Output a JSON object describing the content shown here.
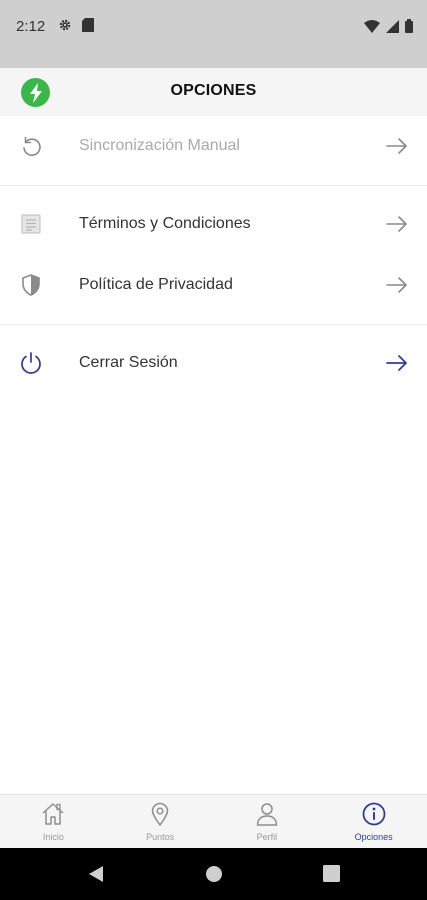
{
  "status_bar": {
    "time": "2:12",
    "icons": [
      "settings-icon",
      "sim-card-icon",
      "wifi-icon",
      "signal-icon",
      "battery-icon"
    ]
  },
  "header": {
    "title": "OPCIONES",
    "logo_icon": "bolt-icon",
    "logo_color": "#3cb64a"
  },
  "menu": {
    "items": [
      {
        "label": "Sincronización Manual",
        "icon": "sync-icon",
        "enabled": false
      },
      {
        "label": "Términos y Condiciones",
        "icon": "document-icon",
        "enabled": true
      },
      {
        "label": "Política de Privacidad",
        "icon": "shield-icon",
        "enabled": true
      },
      {
        "label": "Cerrar Sesión",
        "icon": "power-icon",
        "enabled": true
      }
    ]
  },
  "bottom_nav": {
    "items": [
      {
        "label": "Inicio",
        "icon": "home-icon",
        "active": false
      },
      {
        "label": "Puntos",
        "icon": "location-pin-icon",
        "active": false
      },
      {
        "label": "Perfil",
        "icon": "person-icon",
        "active": false
      },
      {
        "label": "Opciones",
        "icon": "info-icon",
        "active": true
      }
    ]
  },
  "colors": {
    "accent": "#2f3e8f",
    "muted": "#9a9a9a",
    "brand_green": "#3cb64a"
  }
}
